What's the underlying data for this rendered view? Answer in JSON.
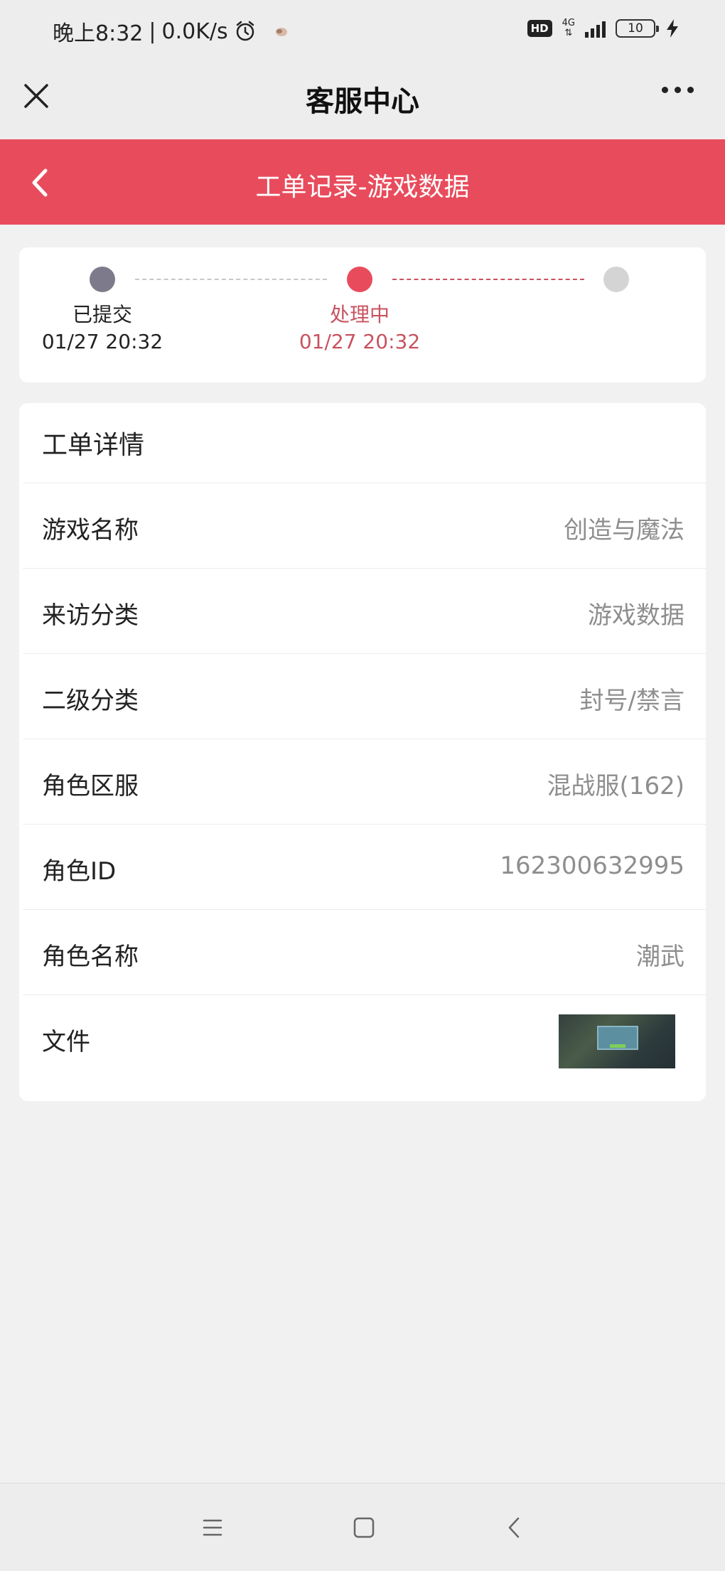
{
  "status_bar": {
    "time": "晚上8:32",
    "speed": "0.0K/s",
    "alarm_icon": "alarm-clock-icon",
    "hd_badge": "HD",
    "network_type": "4G",
    "battery_level": "10"
  },
  "title_bar": {
    "close_icon": "close-icon",
    "title": "客服中心",
    "more_icon": "more-dots-icon"
  },
  "header": {
    "back_icon": "chevron-left-icon",
    "title": "工单记录-游戏数据",
    "color": "#e84c5c"
  },
  "progress": {
    "steps": [
      {
        "label": "已提交",
        "time": "01/27 20:32",
        "state": "done",
        "color": "#7d7b8b"
      },
      {
        "label": "处理中",
        "time": "01/27 20:32",
        "state": "current",
        "color": "#e84c5c"
      },
      {
        "label": "",
        "time": "",
        "state": "pending",
        "color": "#d4d4d4"
      }
    ]
  },
  "detail": {
    "title": "工单详情",
    "rows": [
      {
        "label": "游戏名称",
        "value": "创造与魔法"
      },
      {
        "label": "来访分类",
        "value": "游戏数据"
      },
      {
        "label": "二级分类",
        "value": "封号/禁言"
      },
      {
        "label": "角色区服",
        "value": "混战服(162)"
      },
      {
        "label": "角色ID",
        "value": "162300632995"
      },
      {
        "label": "角色名称",
        "value": "潮武"
      }
    ],
    "file": {
      "label": "文件",
      "thumbnail": "game-screenshot-thumbnail"
    }
  },
  "nav_bar": {
    "menu_icon": "menu-icon",
    "home_icon": "home-square-icon",
    "back_icon": "back-triangle-icon"
  }
}
